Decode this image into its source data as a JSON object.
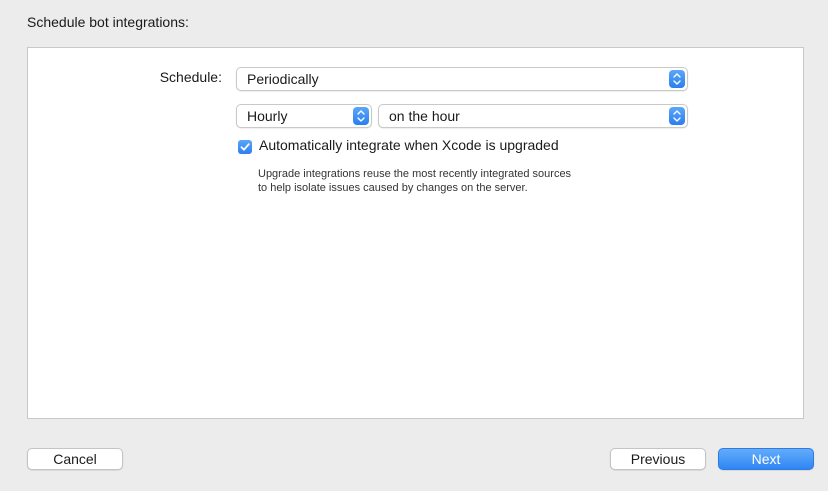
{
  "sheet": {
    "title": "Schedule bot integrations:"
  },
  "schedule": {
    "label": "Schedule:",
    "value": "Periodically",
    "frequency": "Hourly",
    "timing": "on the hour"
  },
  "upgrade_option": {
    "checked": true,
    "label": "Automatically integrate when Xcode is upgraded",
    "help_line1": "Upgrade integrations reuse the most recently integrated sources",
    "help_line2": "to help isolate issues caused by changes on the server."
  },
  "footer": {
    "cancel_label": "Cancel",
    "previous_label": "Previous",
    "next_label": "Next"
  },
  "colors": {
    "accent": "#2f86f3",
    "window_bg": "#ececec",
    "panel_bg": "#ffffff"
  },
  "icons": {
    "popup_stepper": "up-down-chevron-icon",
    "checkbox_mark": "checkmark-icon"
  }
}
